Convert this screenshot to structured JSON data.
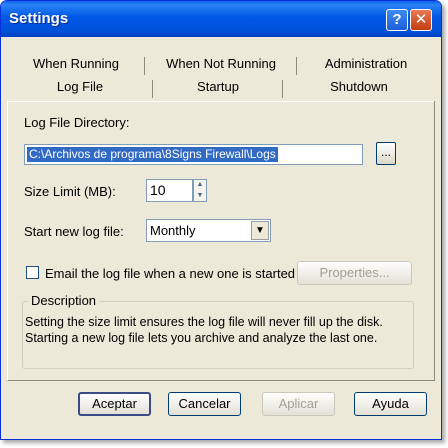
{
  "window": {
    "title": "Settings",
    "help_glyph": "?",
    "close_glyph": "✕"
  },
  "tabs": {
    "row1": [
      "When Running",
      "When Not Running",
      "Administration"
    ],
    "row2": [
      "Log File",
      "Startup",
      "Shutdown"
    ],
    "active": "Log File"
  },
  "log_file": {
    "directory_label": "Log File Directory:",
    "directory_value": "C:\\Archivos de programa\\8Signs Firewall\\Logs",
    "browse_label": "...",
    "size_label": "Size Limit (MB):",
    "size_value": "10",
    "start_label": "Start new log file:",
    "start_value": "Monthly",
    "email_label": "Email the log file when a new one is started",
    "email_checked": false,
    "properties_label": "Properties...",
    "description_title": "Description",
    "description_text": "Setting the size limit ensures the log file will never fill up the disk. Starting a new log file lets you archive and analyze the last one."
  },
  "buttons": {
    "ok": "Aceptar",
    "cancel": "Cancelar",
    "apply": "Aplicar",
    "help": "Ayuda"
  }
}
